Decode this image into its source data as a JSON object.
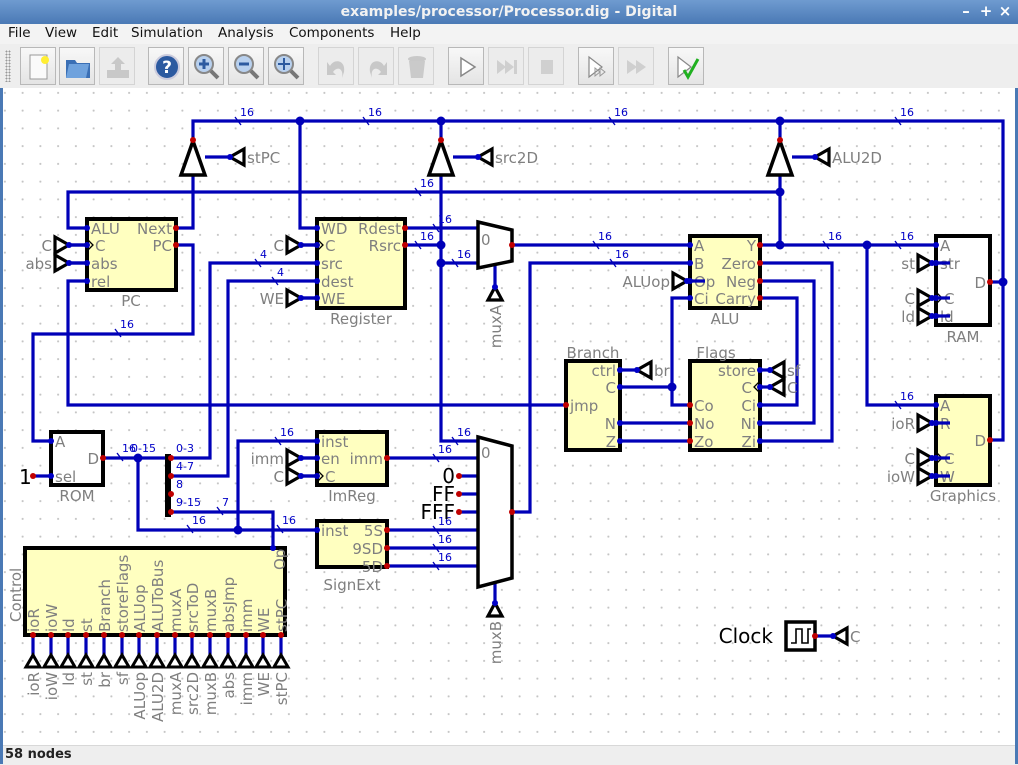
{
  "window": {
    "title": "examples/processor/Processor.dig - Digital",
    "controls": [
      "minimize-icon",
      "maximize-icon",
      "close-icon"
    ]
  },
  "menu": [
    "File",
    "View",
    "Edit",
    "Simulation",
    "Analysis",
    "Components",
    "Help"
  ],
  "toolbar": [
    {
      "name": "new",
      "icon": "new-file-icon",
      "enabled": true
    },
    {
      "name": "open",
      "icon": "open-folder-icon",
      "enabled": true
    },
    {
      "name": "save",
      "icon": "save-icon",
      "enabled": false
    },
    {
      "name": "help",
      "icon": "help-icon",
      "enabled": true
    },
    {
      "name": "zoom-in",
      "icon": "zoom-in-icon",
      "enabled": true
    },
    {
      "name": "zoom-out",
      "icon": "zoom-out-icon",
      "enabled": true
    },
    {
      "name": "fit",
      "icon": "zoom-fit-icon",
      "enabled": true
    },
    {
      "name": "undo",
      "icon": "undo-icon",
      "enabled": false
    },
    {
      "name": "redo",
      "icon": "redo-icon",
      "enabled": false
    },
    {
      "name": "delete",
      "icon": "trash-icon",
      "enabled": false
    },
    {
      "name": "start",
      "icon": "play-icon",
      "enabled": true
    },
    {
      "name": "step",
      "icon": "step-icon",
      "enabled": false
    },
    {
      "name": "stop",
      "icon": "stop-icon",
      "enabled": false
    },
    {
      "name": "micro-step",
      "icon": "micro-step-icon",
      "enabled": true
    },
    {
      "name": "fast-run",
      "icon": "fast-forward-icon",
      "enabled": false
    },
    {
      "name": "run-tests",
      "icon": "test-check-icon",
      "enabled": true
    }
  ],
  "colors": {
    "wire": "#0000b8",
    "pin_out": "#c00000",
    "pin_in": "#0000c8",
    "component_fill": "#ffffc0",
    "check": "#20b020"
  },
  "components": {
    "pc": {
      "label": "PC",
      "pins": [
        "ALU",
        "C",
        "abs",
        "rel",
        "Next",
        "PC"
      ]
    },
    "register": {
      "label": "Register",
      "pins": [
        "WD",
        "C",
        "src",
        "dest",
        "WE",
        "Rdest",
        "Rsrc"
      ]
    },
    "alu": {
      "label": "ALU",
      "pins": [
        "A",
        "B",
        "Op",
        "Ci",
        "Y",
        "Zero",
        "Neg",
        "Carry"
      ]
    },
    "ram": {
      "label": "RAM",
      "pins": [
        "A",
        "str",
        "C",
        "ld",
        "D"
      ]
    },
    "graphics": {
      "label": "Graphics",
      "pins": [
        "A",
        "R",
        "C",
        "W",
        "D"
      ]
    },
    "rom": {
      "label": "ROM",
      "pins": [
        "A",
        "sel",
        "D"
      ]
    },
    "imreg": {
      "label": "ImReg",
      "pins": [
        "inst",
        "en",
        "C",
        "imm"
      ]
    },
    "signext": {
      "label": "SignExt",
      "pins": [
        "inst",
        "5S",
        "9SD",
        "5D"
      ]
    },
    "branch": {
      "label": "Branch",
      "pins": [
        "jmp",
        "ctrl",
        "C",
        "N",
        "Z"
      ]
    },
    "flags": {
      "label": "Flags",
      "pins": [
        "Co",
        "No",
        "Zo",
        "store",
        "C",
        "Ci",
        "Ni",
        "Zi"
      ]
    },
    "control": {
      "label": "Control",
      "pins": [
        "ioR",
        "ioW",
        "ld",
        "st",
        "Branch",
        "storeFlags",
        "ALUop",
        "ALUToBus",
        "muxA",
        "srcToD",
        "muxB",
        "absJmp",
        "imm",
        "WE",
        "stPC"
      ],
      "op_pin": "Op"
    }
  },
  "muxes": {
    "muxA": {
      "label": "muxA",
      "first_input": "0"
    },
    "muxB": {
      "label": "muxB",
      "first_input": "0"
    }
  },
  "inputs": {
    "pc_c": "C",
    "pc_abs": "abs",
    "reg_c": "C",
    "reg_we": "WE",
    "imreg_imm": "imm",
    "imreg_c": "C",
    "alu_op": "ALUop",
    "ram_st": "st",
    "ram_c": "C",
    "ram_ld": "ld",
    "gfx_ior": "ioR",
    "gfx_c": "C",
    "gfx_iow": "ioW",
    "stpc": "stPC",
    "src2d": "src2D",
    "alu2d": "ALU2D",
    "br": "br",
    "sf": "sf",
    "flags_c": "C",
    "clock_c": "C"
  },
  "control_outputs": [
    "ioR",
    "ioW",
    "ld",
    "st",
    "br",
    "sf",
    "ALUop",
    "ALU2D",
    "muxA",
    "src2D",
    "muxB",
    "abs",
    "imm",
    "WE",
    "stPC"
  ],
  "constants": {
    "rom_sel": "1",
    "zero": "0",
    "ff": "FF",
    "fff": "FFF"
  },
  "splitter": {
    "input": "0-15",
    "outputs": [
      "0-3",
      "4-7",
      "8",
      "9-15"
    ]
  },
  "bus_widths": [
    "16",
    "16",
    "16",
    "16",
    "16",
    "16",
    "4",
    "4",
    "16",
    "16",
    "16",
    "16",
    "16",
    "16",
    "16",
    "16",
    "16",
    "16",
    "16",
    "16",
    "16",
    "16",
    "7",
    "16",
    "16",
    "16"
  ],
  "clock": {
    "label": "Clock"
  },
  "status": "58 nodes"
}
